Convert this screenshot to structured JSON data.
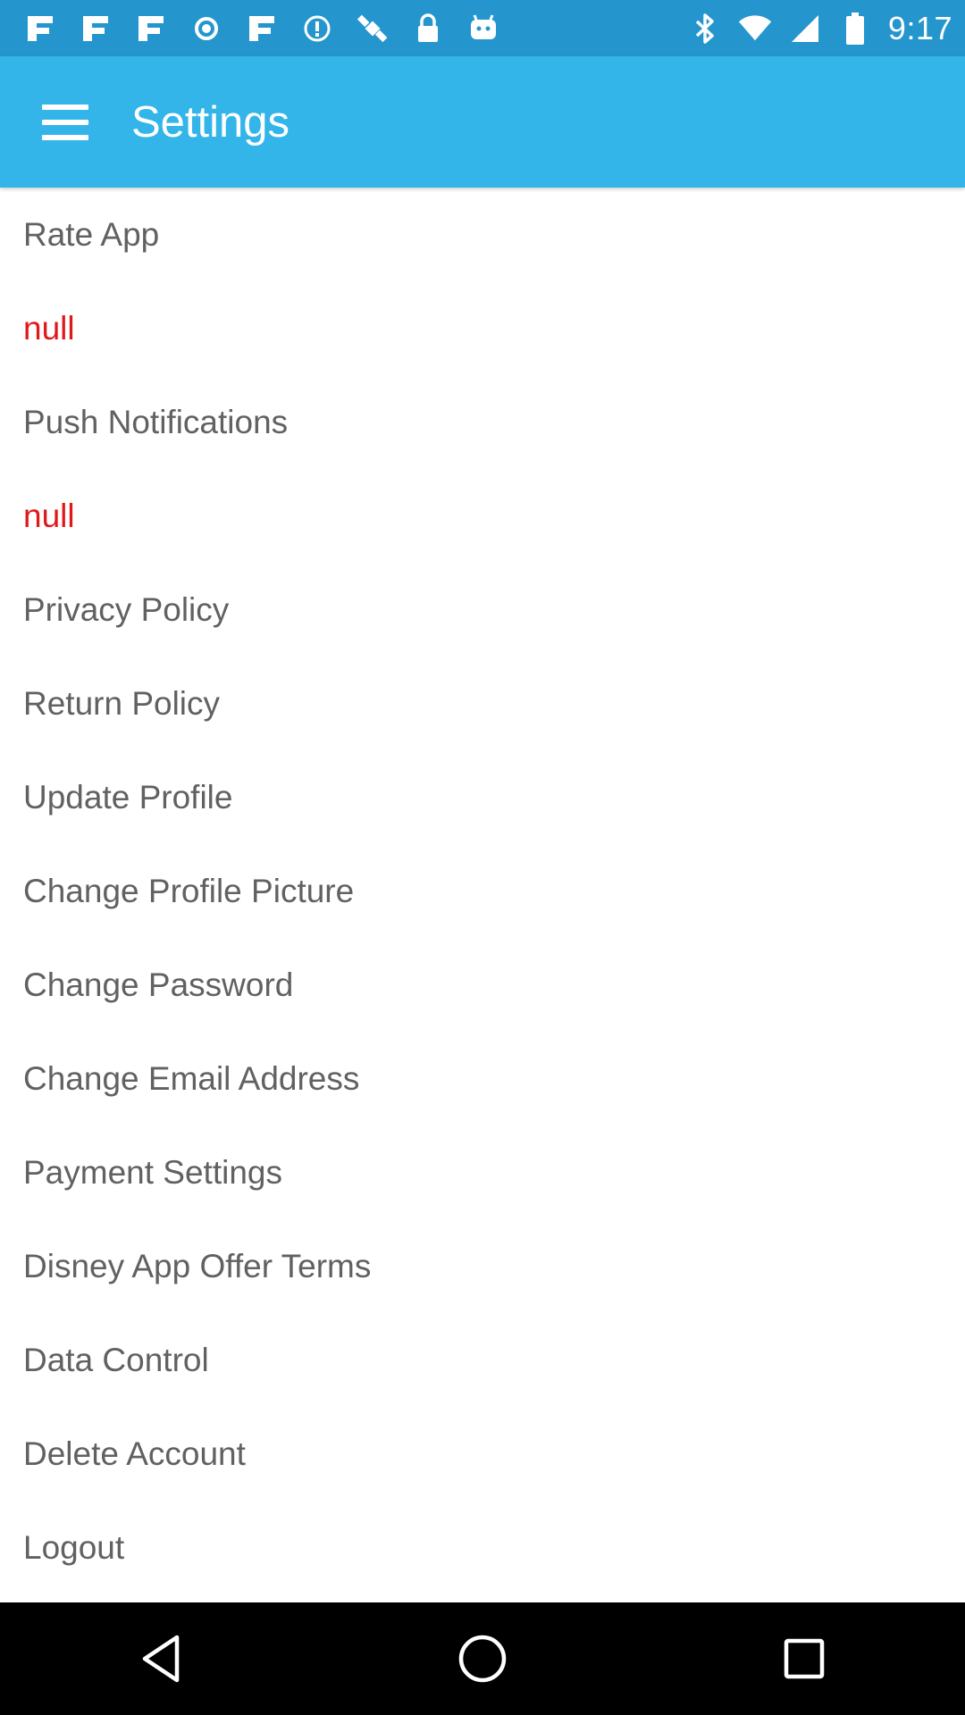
{
  "status_bar": {
    "time": "9:17",
    "left_icons": [
      "fan-icon",
      "fan-icon",
      "fan-icon",
      "circle-dot-icon",
      "fan-icon",
      "alert-circle-icon",
      "fake-gps-icon",
      "lock-icon",
      "android-icon"
    ],
    "right_icons": [
      "bluetooth-icon",
      "wifi-icon",
      "signal-icon",
      "battery-icon"
    ],
    "background": "#2496cd"
  },
  "app_bar": {
    "title": "Settings",
    "menu_icon": "hamburger-menu-icon",
    "background": "#33b5e9"
  },
  "settings": {
    "items": [
      {
        "label": "Rate App",
        "color": "#616161"
      },
      {
        "label": "null",
        "color": "#e01818"
      },
      {
        "label": "Push Notifications",
        "color": "#616161"
      },
      {
        "label": "null",
        "color": "#e01818"
      },
      {
        "label": "Privacy Policy",
        "color": "#616161"
      },
      {
        "label": "Return Policy",
        "color": "#616161"
      },
      {
        "label": "Update Profile",
        "color": "#616161"
      },
      {
        "label": "Change Profile Picture",
        "color": "#616161"
      },
      {
        "label": "Change Password",
        "color": "#616161"
      },
      {
        "label": "Change Email Address",
        "color": "#616161"
      },
      {
        "label": "Payment Settings",
        "color": "#616161"
      },
      {
        "label": "Disney App Offer Terms",
        "color": "#616161"
      },
      {
        "label": "Data Control",
        "color": "#616161"
      },
      {
        "label": "Delete Account",
        "color": "#616161"
      },
      {
        "label": "Logout",
        "color": "#616161"
      }
    ]
  },
  "nav_bar": {
    "buttons": [
      "back-icon",
      "home-icon",
      "recents-icon"
    ]
  }
}
